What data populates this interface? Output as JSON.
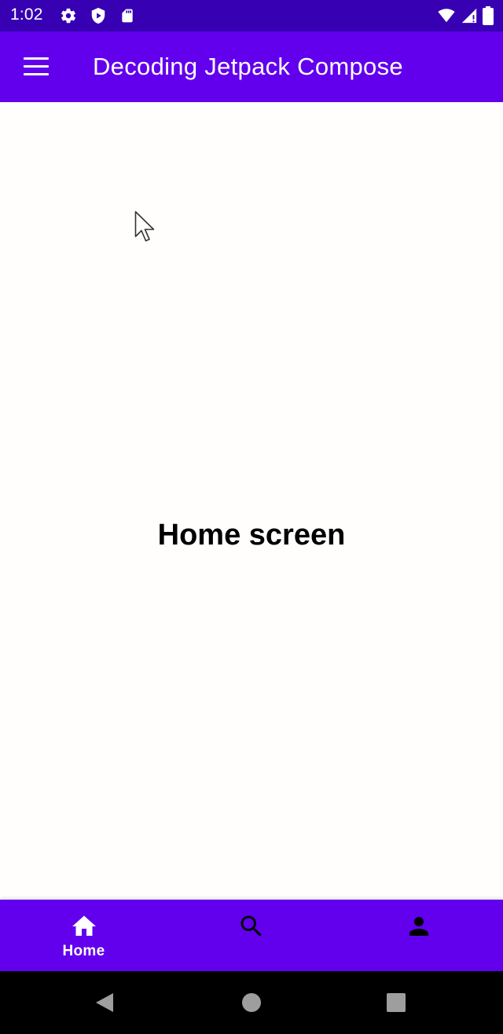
{
  "status_bar": {
    "time": "1:02",
    "left_icons": [
      "gear-icon",
      "shield-play-icon",
      "sd-card-icon"
    ],
    "right_icons": [
      "wifi-icon",
      "cellular-signal-icon",
      "battery-icon"
    ]
  },
  "app_bar": {
    "title": "Decoding Jetpack Compose",
    "nav_icon": "menu-icon",
    "background": "#6200ee"
  },
  "main": {
    "label": "Home screen"
  },
  "bottom_nav": {
    "items": [
      {
        "label": "Home",
        "icon": "home-icon",
        "selected": true
      },
      {
        "label": "",
        "icon": "search-icon",
        "selected": false
      },
      {
        "label": "",
        "icon": "person-icon",
        "selected": false
      }
    ]
  },
  "system_nav": {
    "buttons": [
      "back-icon",
      "home-circle-icon",
      "recents-icon"
    ]
  },
  "colors": {
    "status_bar": "#3700b3",
    "primary": "#6200ee",
    "background": "#fffefd"
  }
}
